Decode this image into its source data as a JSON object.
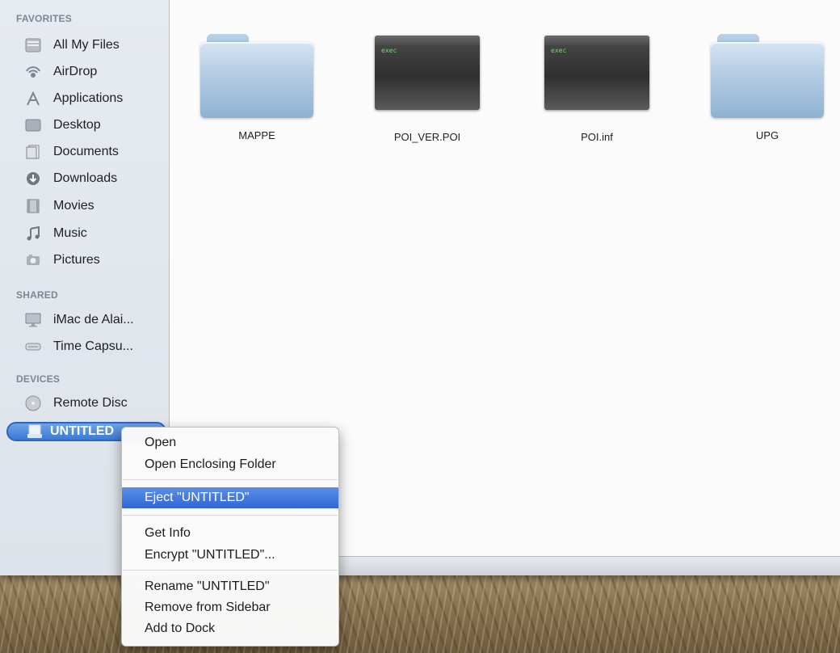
{
  "sidebar": {
    "favorites_header": "FAVORITES",
    "favorites": [
      {
        "label": "All My Files",
        "icon": "all-files-icon"
      },
      {
        "label": "AirDrop",
        "icon": "airdrop-icon"
      },
      {
        "label": "Applications",
        "icon": "applications-icon"
      },
      {
        "label": "Desktop",
        "icon": "desktop-icon"
      },
      {
        "label": "Documents",
        "icon": "documents-icon"
      },
      {
        "label": "Downloads",
        "icon": "downloads-icon"
      },
      {
        "label": "Movies",
        "icon": "movies-icon"
      },
      {
        "label": "Music",
        "icon": "music-icon"
      },
      {
        "label": "Pictures",
        "icon": "pictures-icon"
      }
    ],
    "shared_header": "SHARED",
    "shared": [
      {
        "label": "iMac de Alai...",
        "icon": "imac-icon"
      },
      {
        "label": "Time Capsu...",
        "icon": "time-capsule-icon"
      }
    ],
    "devices_header": "DEVICES",
    "devices": [
      {
        "label": "Remote Disc",
        "icon": "remote-disc-icon"
      },
      {
        "label": "UNTITLED",
        "icon": "drive-icon",
        "selected": true
      }
    ]
  },
  "files": [
    {
      "name": "MAPPE",
      "kind": "folder"
    },
    {
      "name": "POI_VER.POI",
      "kind": "exec",
      "badge": "exec"
    },
    {
      "name": "POI.inf",
      "kind": "exec",
      "badge": "exec"
    },
    {
      "name": "UPG",
      "kind": "folder"
    }
  ],
  "context_menu": {
    "items": [
      {
        "label": "Open"
      },
      {
        "label": "Open Enclosing Folder"
      },
      {
        "label": "Eject \"UNTITLED\"",
        "highlighted": true
      },
      {
        "label": "Get Info"
      },
      {
        "label": "Encrypt \"UNTITLED\"..."
      },
      {
        "label": "Rename \"UNTITLED\""
      },
      {
        "label": "Remove from Sidebar"
      },
      {
        "label": "Add to Dock"
      }
    ]
  },
  "colors": {
    "selection": "#3a7ad6",
    "menu_highlight": "#2f66d5",
    "sidebar_bg": "#e2e8ef",
    "folder": "#a9c6e2"
  }
}
